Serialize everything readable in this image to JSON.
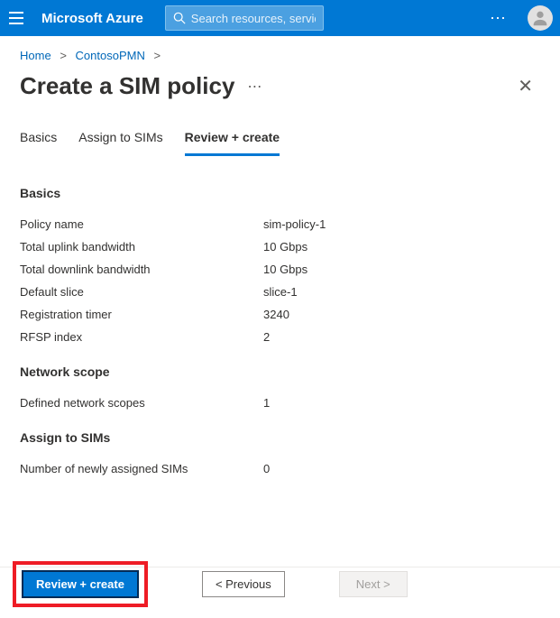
{
  "topbar": {
    "brand": "Microsoft Azure",
    "search_placeholder": "Search resources, services, and docs (G+/)"
  },
  "breadcrumb": {
    "home": "Home",
    "item1": "ContosoPMN"
  },
  "title": "Create a SIM policy",
  "tabs": {
    "basics": "Basics",
    "assign": "Assign to SIMs",
    "review": "Review + create"
  },
  "sections": {
    "basics_head": "Basics",
    "basics": [
      {
        "k": "Policy name",
        "v": "sim-policy-1"
      },
      {
        "k": "Total uplink bandwidth",
        "v": "10 Gbps"
      },
      {
        "k": "Total downlink bandwidth",
        "v": "10 Gbps"
      },
      {
        "k": "Default slice",
        "v": "slice-1"
      },
      {
        "k": "Registration timer",
        "v": "3240"
      },
      {
        "k": "RFSP index",
        "v": "2"
      }
    ],
    "network_head": "Network scope",
    "network": [
      {
        "k": "Defined network scopes",
        "v": "1"
      }
    ],
    "assign_head": "Assign to SIMs",
    "assign": [
      {
        "k": "Number of newly assigned SIMs",
        "v": "0"
      }
    ]
  },
  "footer": {
    "review_create": "Review + create",
    "previous": "< Previous",
    "next": "Next >"
  }
}
